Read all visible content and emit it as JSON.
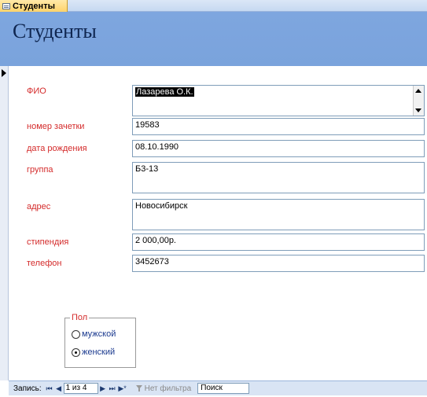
{
  "tab": {
    "label": "Студенты",
    "icon": "form-icon"
  },
  "form": {
    "title": "Студенты"
  },
  "fields": {
    "fio": {
      "label": "ФИО",
      "value": "Лазарева О.К."
    },
    "zachetka": {
      "label": "номер зачетки",
      "value": "19583"
    },
    "birth": {
      "label": "дата рождения",
      "value": "08.10.1990"
    },
    "group": {
      "label": "группа",
      "value": "Б3-13"
    },
    "address": {
      "label": "адрес",
      "value": "Новосибирск"
    },
    "stipend": {
      "label": "стипендия",
      "value": "2 000,00р."
    },
    "phone": {
      "label": "телефон",
      "value": "3452673"
    }
  },
  "gender": {
    "legend": "Пол",
    "options": [
      {
        "label": "мужской",
        "checked": false
      },
      {
        "label": "женский",
        "checked": true
      }
    ]
  },
  "navbar": {
    "record_label": "Запись:",
    "first": "⏮",
    "prev": "◀",
    "next": "▶",
    "last": "⏭",
    "new": "▶*",
    "position": "1 из 4",
    "filter_label": "Нет фильтра",
    "search_placeholder": "Поиск"
  }
}
